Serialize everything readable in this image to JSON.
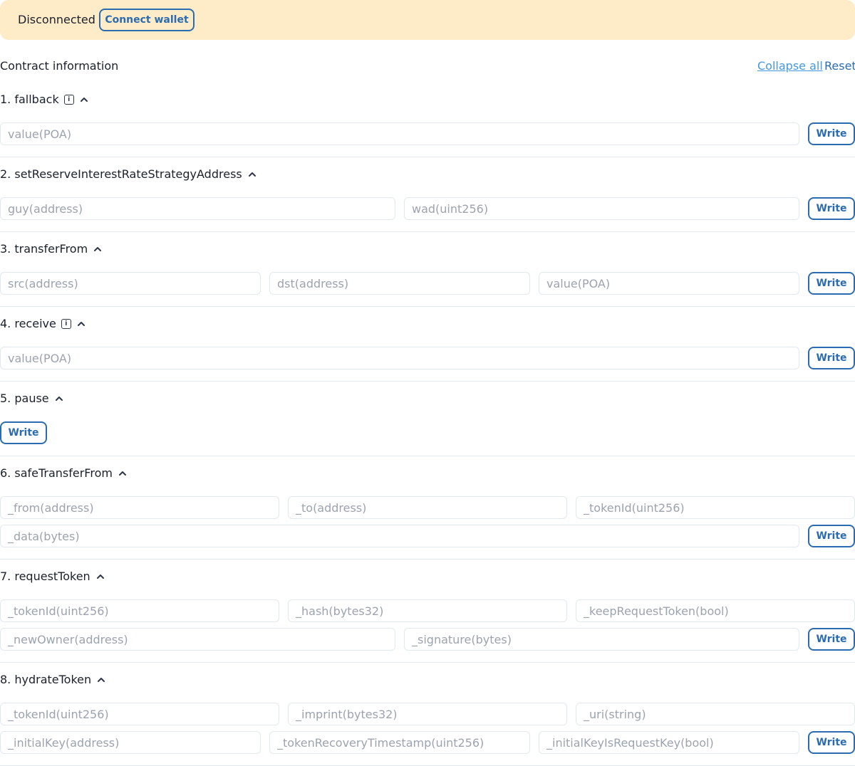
{
  "banner": {
    "status": "Disconnected",
    "connect_label": "Connect wallet"
  },
  "contract": {
    "title": "Contract information",
    "collapse_all": "Collapse all",
    "reset": "Reset"
  },
  "methods": [
    {
      "title": "1. fallback",
      "has_info": true,
      "inputs": [
        "value(POA)"
      ],
      "write": "Write"
    },
    {
      "title": "2. setReserveInterestRateStrategyAddress",
      "has_info": false,
      "inputs": [
        "guy(address)",
        "wad(uint256)"
      ],
      "write": "Write"
    },
    {
      "title": "3. transferFrom",
      "has_info": false,
      "inputs": [
        "src(address)",
        "dst(address)",
        "value(POA)"
      ],
      "write": "Write"
    },
    {
      "title": "4. receive",
      "has_info": true,
      "inputs": [
        "value(POA)"
      ],
      "write": "Write"
    },
    {
      "title": "5. pause",
      "has_info": false,
      "inputs": [],
      "write": "Write"
    },
    {
      "title": "6. safeTransferFrom",
      "has_info": false,
      "inputs": [
        "_from(address)",
        "_to(address)",
        "_tokenId(uint256)",
        "_data(bytes)"
      ],
      "write": "Write"
    },
    {
      "title": "7. requestToken",
      "has_info": false,
      "inputs": [
        "_tokenId(uint256)",
        "_hash(bytes32)",
        "_keepRequestToken(bool)",
        "_newOwner(address)",
        "_signature(bytes)"
      ],
      "write": "Write"
    },
    {
      "title": "8. hydrateToken",
      "has_info": false,
      "inputs": [
        "_tokenId(uint256)",
        "_imprint(bytes32)",
        "_uri(string)",
        "_initialKey(address)",
        "_tokenRecoveryTimestamp(uint256)",
        "_initialKeyIsRequestKey(bool)"
      ],
      "write": "Write"
    }
  ],
  "icons": {
    "info": "info-icon",
    "collapse": "chevron-up-icon"
  },
  "colors": {
    "banner_bg": "#feebc8",
    "accent": "#2b6cb0",
    "link": "#4299e1"
  }
}
